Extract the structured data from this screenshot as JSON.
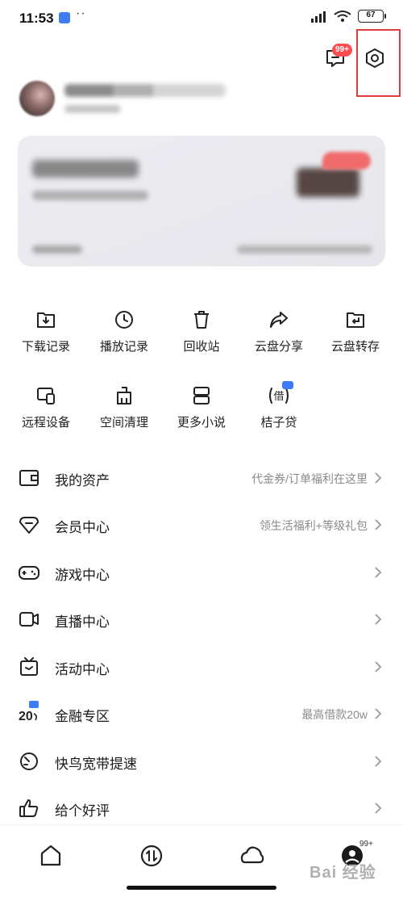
{
  "status_bar": {
    "time": "11:53",
    "dots": "··",
    "battery": "67"
  },
  "header": {
    "message_badge": "99+",
    "icons": [
      "message-icon",
      "settings-icon"
    ],
    "highlight_color": "#e03c3c"
  },
  "profile": {
    "avatar": "avatar-blurred"
  },
  "vip_card": {
    "background": "#ececf1",
    "badge_color": "#f06b6b"
  },
  "grid": {
    "items": [
      {
        "label": "下载记录",
        "icon": "download-folder-icon"
      },
      {
        "label": "播放记录",
        "icon": "clock-icon"
      },
      {
        "label": "回收站",
        "icon": "trash-icon"
      },
      {
        "label": "云盘分享",
        "icon": "share-arrow-icon"
      },
      {
        "label": "云盘转存",
        "icon": "folder-return-icon"
      },
      {
        "label": "远程设备",
        "icon": "remote-device-icon"
      },
      {
        "label": "空间清理",
        "icon": "broom-icon"
      },
      {
        "label": "更多小说",
        "icon": "book-icon"
      },
      {
        "label": "桔子贷",
        "icon": "loan-icon"
      }
    ],
    "loan_icon_text": "借"
  },
  "menu": {
    "items": [
      {
        "label": "我的资产",
        "hint": "代金券/订单福利在这里",
        "icon": "wallet-icon"
      },
      {
        "label": "会员中心",
        "hint": "领生活福利+等级礼包",
        "icon": "diamond-icon"
      },
      {
        "label": "游戏中心",
        "hint": "",
        "icon": "gamepad-icon"
      },
      {
        "label": "直播中心",
        "hint": "",
        "icon": "video-camera-icon"
      },
      {
        "label": "活动中心",
        "hint": "",
        "icon": "tv-icon"
      },
      {
        "label": "金融专区",
        "hint": "最高借款20w",
        "icon": "finance-20-icon"
      },
      {
        "label": "快鸟宽带提速",
        "hint": "",
        "icon": "speedometer-icon"
      },
      {
        "label": "给个好评",
        "hint": "",
        "icon": "thumbs-up-icon"
      }
    ],
    "finance_icon_text": "20"
  },
  "bottom_nav": {
    "tabs": [
      "home-tab",
      "transfer-tab",
      "cloud-tab",
      "profile-tab"
    ],
    "profile_badge": "99+"
  },
  "watermark": "Bai 经验"
}
